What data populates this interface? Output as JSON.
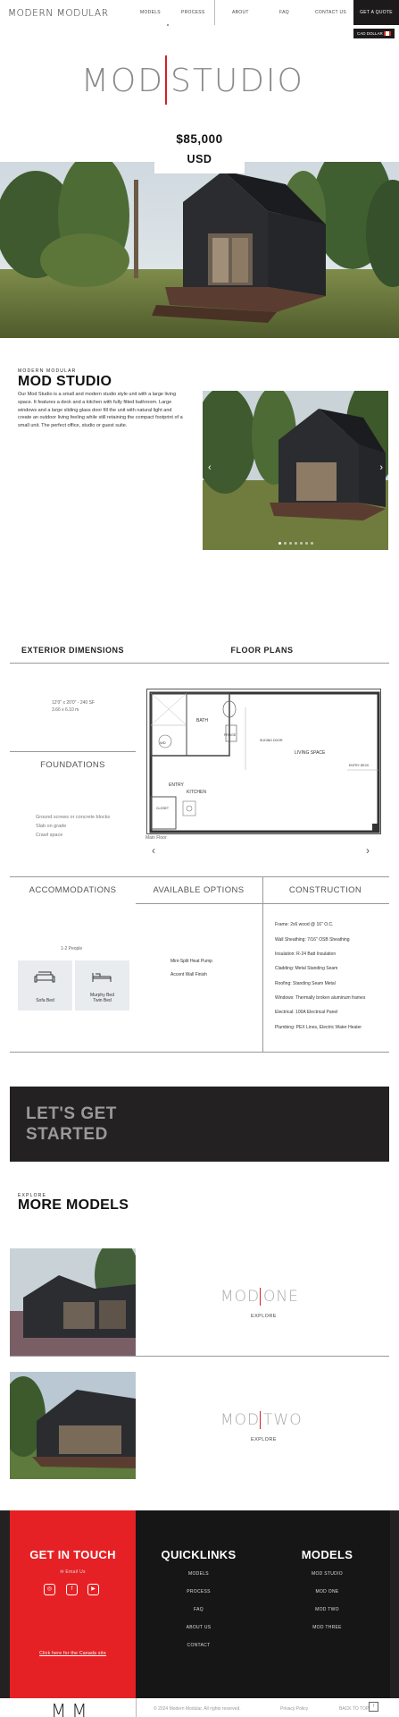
{
  "header": {
    "logo": "MODERN MODULAR",
    "nav": [
      "MODELS",
      "PROCESS",
      "ABOUT",
      "FAQ",
      "CONTACT US"
    ],
    "cta": "GET A QUOTE",
    "currency": "CAD DOLLAR"
  },
  "hero": {
    "title_left": "MOD",
    "title_right": "STUDIO",
    "price": "$85,000",
    "price_currency": "USD"
  },
  "model": {
    "eyebrow": "MODERN MODULAR",
    "title": "MOD STUDIO",
    "description": "Our Mod Studio is a small and modern studio style unit with a large living space. It features a deck and a kitchen with fully fitted bathroom. Large windows and a large sliding glass door fill the unit with natural light and create an outdoor living feeling while still retaining the compact footprint of a small unit. The perfect office, studio or guest suite."
  },
  "specs": {
    "exterior_head": "EXTERIOR DIMENSIONS",
    "floorplans_head": "FLOOR PLANS",
    "dimensions_line1": "12'0\" x 20'0\" - 240 SF",
    "dimensions_line2": "3.66 x 6.10 m",
    "foundations_head": "FOUNDATIONS",
    "foundations": [
      "Ground screws or concrete blocks",
      "Slab on grade",
      "Crawl space"
    ],
    "plan_label": "Main Floor",
    "plan_rooms": [
      "BATH",
      "WD",
      "FRIDGE",
      "LIVING SPACE",
      "ENTRY",
      "KITCHEN",
      "CLOSET",
      "ENTRY DECK",
      "SLIDING DOOR"
    ]
  },
  "details": {
    "acc_head": "ACCOMMODATIONS",
    "options_head": "AVAILABLE OPTIONS",
    "construction_head": "CONSTRUCTION",
    "sleeps": "1-2 People",
    "acc_items": [
      "Sofa Bed",
      "Murphy Bed",
      "Twin Bed"
    ],
    "options": [
      "Mini-Split Heat Pump",
      "Accent Wall Finish"
    ],
    "construction": [
      "Frame: 2x6 wood @ 16\" O.C.",
      "Wall Sheathing: 7/16\" OSB Sheathing",
      "Insulation: R-24 Batt Insulation",
      "Cladding: Metal Standing Seam",
      "Roofing: Standing Seam Metal",
      "Windows: Thermally broken aluminum frames",
      "Electrical: 100A Electrical Panel",
      "Plumbing: PEX Lines, Electric Water Heater"
    ]
  },
  "cta": {
    "line1": "LET'S GET",
    "line2": "STARTED"
  },
  "more": {
    "eyebrow": "EXPLORE",
    "title": "MORE MODELS",
    "models": [
      {
        "left": "MOD",
        "right": "ONE",
        "link": "EXPLORE"
      },
      {
        "left": "MOD",
        "right": "TWO",
        "link": "EXPLORE"
      }
    ]
  },
  "footer": {
    "get_in_touch": "GET IN TOUCH",
    "email": "Email Us",
    "canada_link": "Click here for the Canada site",
    "quicklinks_head": "QUICKLINKS",
    "quicklinks": [
      "MODELS",
      "PROCESS",
      "FAQ",
      "ABOUT US",
      "CONTACT"
    ],
    "models_head": "MODELS",
    "models": [
      "MOD STUDIO",
      "MOD ONE",
      "MOD TWO",
      "MOD THREE"
    ],
    "bottom_logo": "MM",
    "copyright": "© 2024 Modern Modular. All rights reserved.",
    "privacy": "Privacy Policy",
    "top": "BACK TO TOP"
  },
  "colors": {
    "accent_red": "#e62125",
    "dark": "#242122",
    "panel_gray": "#e9ecef"
  }
}
